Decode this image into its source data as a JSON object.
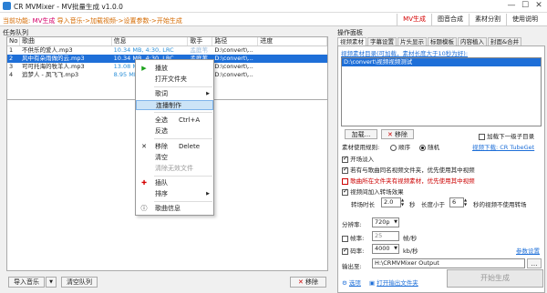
{
  "window": {
    "title": "CR MVMixer - MV批量生成 v1.0.0",
    "min": "—",
    "max": "☐",
    "close": "✕"
  },
  "topbar": {
    "flow_prefix": "当前功能:",
    "flow_current": "MV生成",
    "flow_rest": "导入音乐->加载视频->设置参数->开始生成",
    "tabs": [
      "MV生成",
      "图音合成",
      "素材分割",
      "使用说明"
    ]
  },
  "queue": {
    "label": "任务队列",
    "columns": [
      "No",
      "歌曲",
      "信息",
      "歌手",
      "路径",
      "进度"
    ],
    "rows": [
      {
        "no": "1",
        "song": "不供乐的爱人.mp3",
        "info": "10.34 MB, 4:30, LRC",
        "singer": "孟庭苇",
        "path": "D:\\convert\\...",
        "progress": ""
      },
      {
        "no": "2",
        "song": "风中有朵雨做的云.mp3",
        "info": "10.34 MB, 4:30, LRC",
        "singer": "孟庭苇",
        "path": "D:\\convert\\...",
        "progress": ""
      },
      {
        "no": "3",
        "song": "可可托海的牧羊人.mp3",
        "info": "13.08 MB",
        "singer": "",
        "path": "D:\\convert\\...",
        "progress": ""
      },
      {
        "no": "4",
        "song": "追梦人 - 凤飞飞.mp3",
        "info": "8.95 MB",
        "singer": "",
        "path": "D:\\convert\\...",
        "progress": ""
      }
    ]
  },
  "context_menu": {
    "play": "播放",
    "open_folder": "打开文件夹",
    "lyrics": "歌词",
    "continuous": "连播制作",
    "select_all": "全选",
    "select_all_sc": "Ctrl+A",
    "invert": "反选",
    "remove": "移除",
    "remove_sc": "Delete",
    "clear": "清空",
    "clear_invalid": "清除无效文件",
    "insert": "插队",
    "sort": "排序",
    "song_info": "歌曲信息"
  },
  "bottom": {
    "import": "导入音乐",
    "clear": "清空队列",
    "remove": "移除"
  },
  "panel": {
    "label": "操作面板",
    "tabs": [
      "视频素材",
      "字幕设置",
      "片头显示",
      "标题模板",
      "内容植入",
      "封面&合并"
    ],
    "hint": "视频素材目录(可加载，素材长度大于10秒为好):",
    "video_path": "D:\\convert\\视频视频测试",
    "load": "加载...",
    "remove": "移除",
    "load_subdir": "加载下一级子目录",
    "rule_label": "素材使用规则:",
    "rule_seq": "顺序",
    "rule_random": "随机",
    "video_download": "视频下载: CR TubeGet",
    "fade_in": "开场淡入",
    "use_video_same_name": "若有与歌曲同名视频文件夹，优先使用其中视频",
    "use_video_in_folder": "歌曲所在文件夹有视频素材，优先使用其中视频",
    "transition": "视频间加入转场效果",
    "trans_label": "转场时长",
    "trans_value": "2.0",
    "trans_unit": "秒",
    "len_label": "长度小于",
    "len_value": "6",
    "len_suffix": "秒的视频不使用转场",
    "resolution_label": "分辨率:",
    "resolution_value": "720p",
    "framerate_label": "帧率:",
    "framerate_value": "25",
    "framerate_unit": "帧/秒",
    "bitrate_label": "码率:",
    "bitrate_value": "4000",
    "bitrate_unit": "kb/秒",
    "params": "参数设置",
    "output_label": "输出至:",
    "output_path": "H:\\CRMVMixer Output",
    "options": "选项",
    "open_output": "打开输出文件夹",
    "start": "开始生成"
  }
}
